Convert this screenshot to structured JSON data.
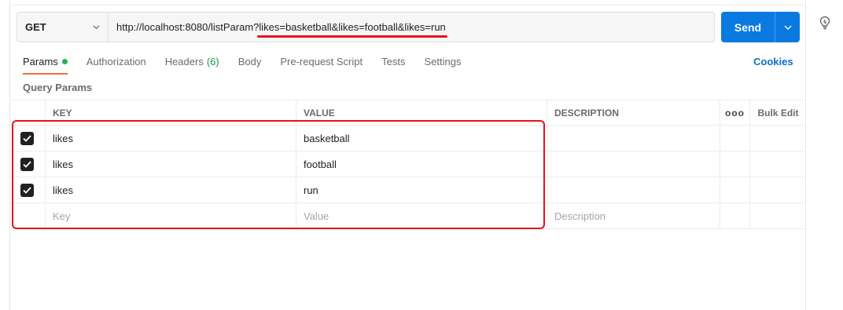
{
  "request": {
    "method": "GET",
    "url_prefix": "http://localhost:8080/listParam?",
    "url_query": "likes=basketball&likes=football&likes=run",
    "send_label": "Send"
  },
  "tabs": [
    {
      "label": "Params"
    },
    {
      "label": "Authorization"
    },
    {
      "label": "Headers",
      "count": "(6)"
    },
    {
      "label": "Body"
    },
    {
      "label": "Pre-request Script"
    },
    {
      "label": "Tests"
    },
    {
      "label": "Settings"
    }
  ],
  "cookies_label": "Cookies",
  "section_title": "Query Params",
  "table": {
    "headers": {
      "key": "KEY",
      "value": "VALUE",
      "description": "DESCRIPTION",
      "more": "ooo",
      "bulk_edit": "Bulk Edit"
    },
    "rows": [
      {
        "key": "likes",
        "value": "basketball",
        "checked": true
      },
      {
        "key": "likes",
        "value": "football",
        "checked": true
      },
      {
        "key": "likes",
        "value": "run",
        "checked": true
      }
    ],
    "placeholders": {
      "key": "Key",
      "value": "Value",
      "description": "Description"
    }
  },
  "colors": {
    "accent": "#0b7ae0",
    "active_tab": "#f26b3a",
    "annotation": "#e8101a",
    "params_dot": "#1eb35b"
  }
}
